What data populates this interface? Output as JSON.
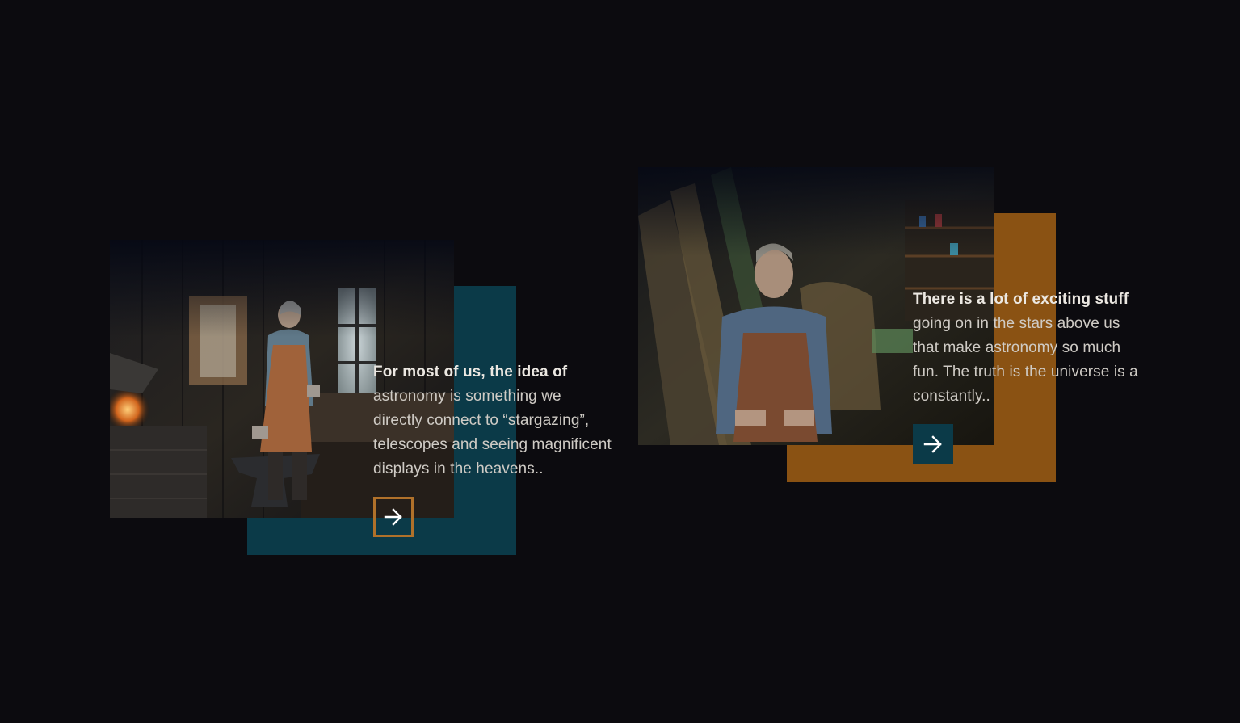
{
  "colors": {
    "background": "#0c0b0f",
    "teal_accent": "#0b3a48",
    "orange_accent": "#8a5213",
    "button_outline_orange": "#b0712a",
    "button_fill_teal": "#0b3a48",
    "arrow_color": "#ffffff"
  },
  "cards": [
    {
      "photo_subject": "blacksmith-workshop-photo",
      "lead_text": "For most of us, the idea of",
      "body_lines": [
        "astronomy is something we",
        "directly connect to “stargazing”,",
        "telescopes and seeing magnificent",
        "displays in the heavens.."
      ],
      "button_icon": "arrow-right-icon",
      "button_style": "outlined-orange"
    },
    {
      "photo_subject": "craftsman-portrait-photo",
      "lead_text": "There is a lot of exciting stuff",
      "body_lines": [
        "going on in the stars above us",
        "that make astronomy so much",
        "fun. The truth is the universe is a",
        "constantly.."
      ],
      "button_icon": "arrow-right-icon",
      "button_style": "filled-teal"
    }
  ]
}
